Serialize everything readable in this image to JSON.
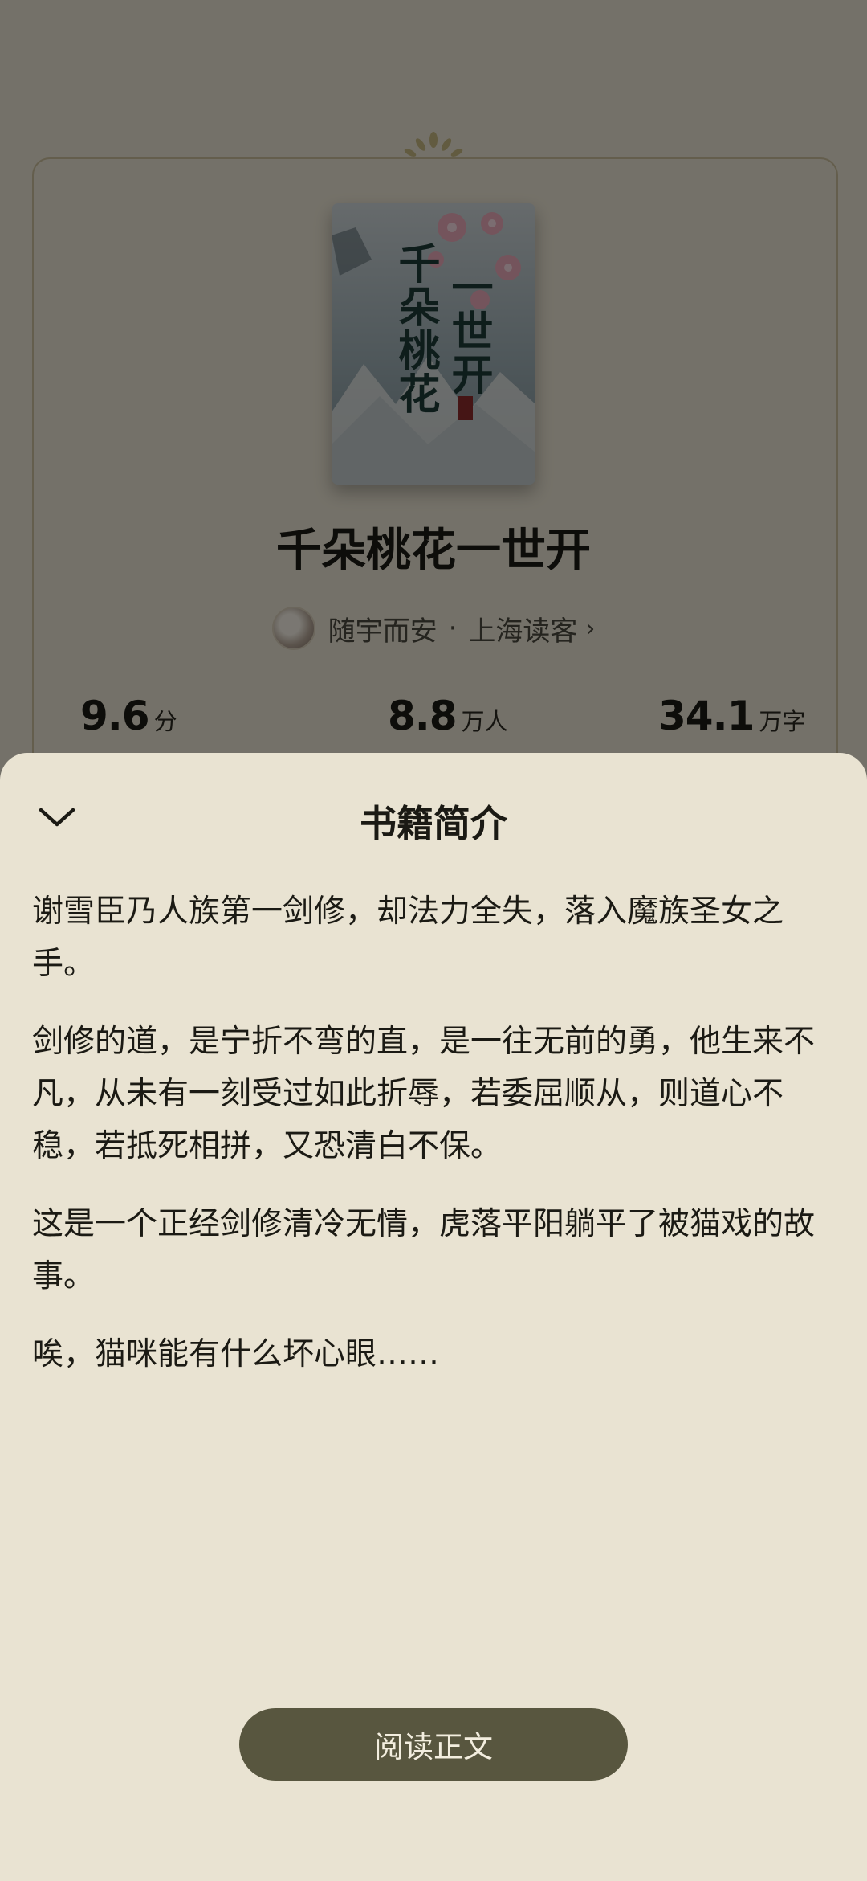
{
  "book": {
    "cover_title_lines": [
      "千朵桃花",
      "一世开"
    ],
    "title": "千朵桃花一世开",
    "author": "随宇而安",
    "separator": "·",
    "publisher": "上海读客",
    "author_chevron": "›"
  },
  "stats": [
    {
      "value": "9.6",
      "unit": "分"
    },
    {
      "value": "8.8",
      "unit": "万人"
    },
    {
      "value": "34.1",
      "unit": "万字"
    }
  ],
  "sheet": {
    "title": "书籍简介",
    "paragraphs": [
      "谢雪臣乃人族第一剑修，却法力全失，落入魔族圣女之手。",
      "剑修的道，是宁折不弯的直，是一往无前的勇，他生来不凡，从未有一刻受过如此折辱，若委屈顺从，则道心不稳，若抵死相拼，又恐清白不保。",
      "这是一个正经剑修清冷无情，虎落平阳躺平了被猫戏的故事。",
      "唉，猫咪能有什么坏心眼……"
    ],
    "read_button": "阅读正文"
  },
  "colors": {
    "background": "#e9e3d2",
    "button": "#58563f",
    "text": "#1b1a14",
    "overlay": "rgba(0,0,0,0.5)"
  },
  "icons": {
    "collapse": "chevron-down-icon",
    "ornament": "leaf-ornament-icon"
  }
}
